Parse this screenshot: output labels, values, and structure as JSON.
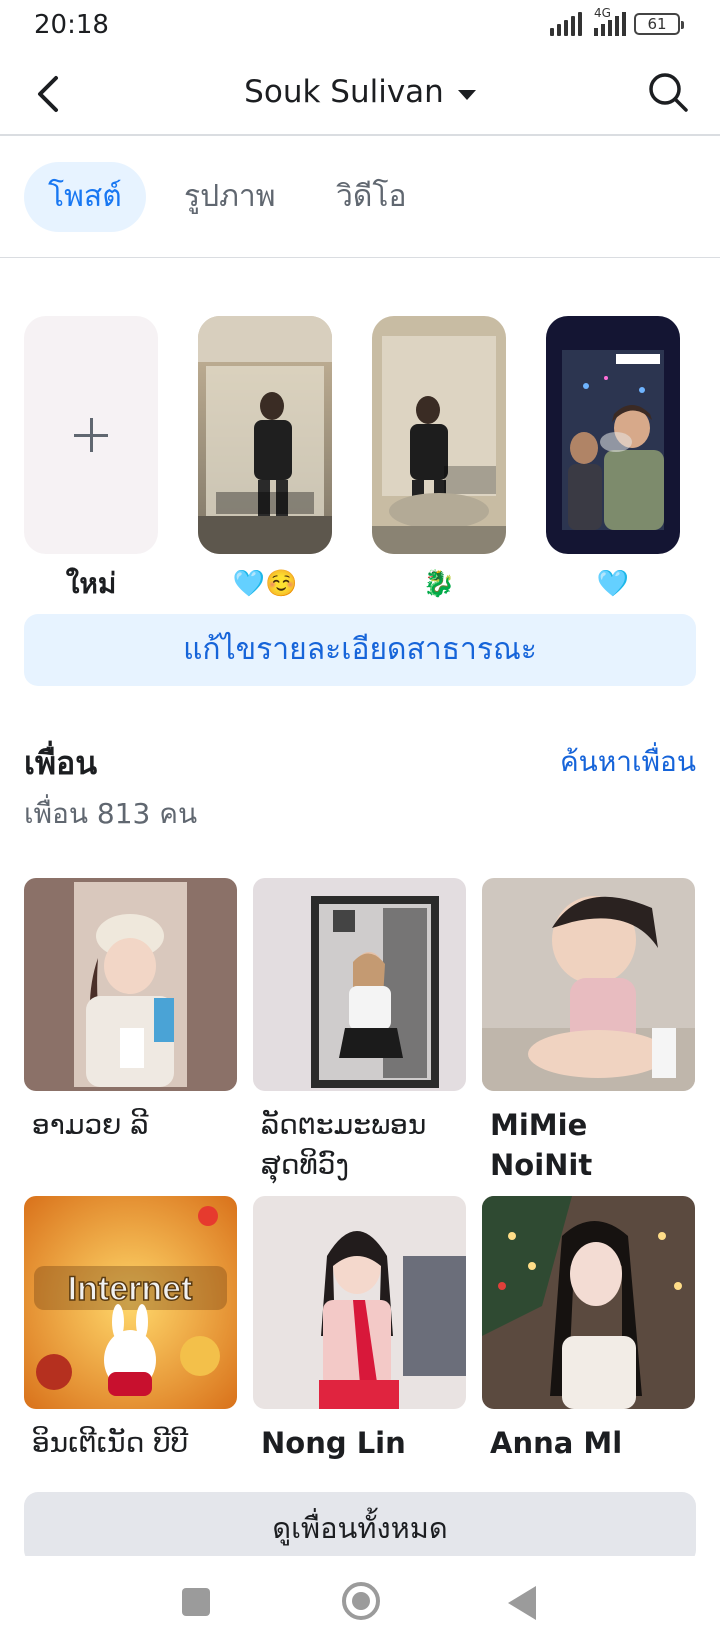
{
  "status": {
    "time": "20:18",
    "network": "4G",
    "battery": "61"
  },
  "header": {
    "title": "Souk Sulivan",
    "back_icon": "back-chevron-icon",
    "dropdown_icon": "caret-down-icon",
    "search_icon": "search-icon"
  },
  "tabs": [
    {
      "label": "โพสต์",
      "active": true
    },
    {
      "label": "รูปภาพ",
      "active": false
    },
    {
      "label": "วิดีโอ",
      "active": false
    }
  ],
  "highlights": {
    "new_label": "ใหม่",
    "items": [
      {
        "label": "🩵☺️"
      },
      {
        "label": "🐉"
      },
      {
        "label": "🩵"
      }
    ]
  },
  "edit_public_details": "แก้ไขรายละเอียดสาธารณะ",
  "friends": {
    "title": "เพื่อน",
    "find_link": "ค้นหาเพื่อน",
    "count": "เพื่อน 813 คน",
    "list": [
      {
        "name": "ອາມວຍ ລີ"
      },
      {
        "name": "ລັດຕະມະພອນ ສຸດທິວົງ"
      },
      {
        "name": "MiMie NoiNit"
      },
      {
        "name": "ອິນເຕີເນັດ ບີບີ"
      },
      {
        "name": "Nong Lin"
      },
      {
        "name": "Anna Ml"
      }
    ],
    "see_all": "ดูเพื่อนทั้งหมด"
  },
  "colors": {
    "accent": "#1877f2",
    "link": "#1664d9",
    "tab_active_bg": "#e7f3ff",
    "secondary_text": "#606770"
  }
}
